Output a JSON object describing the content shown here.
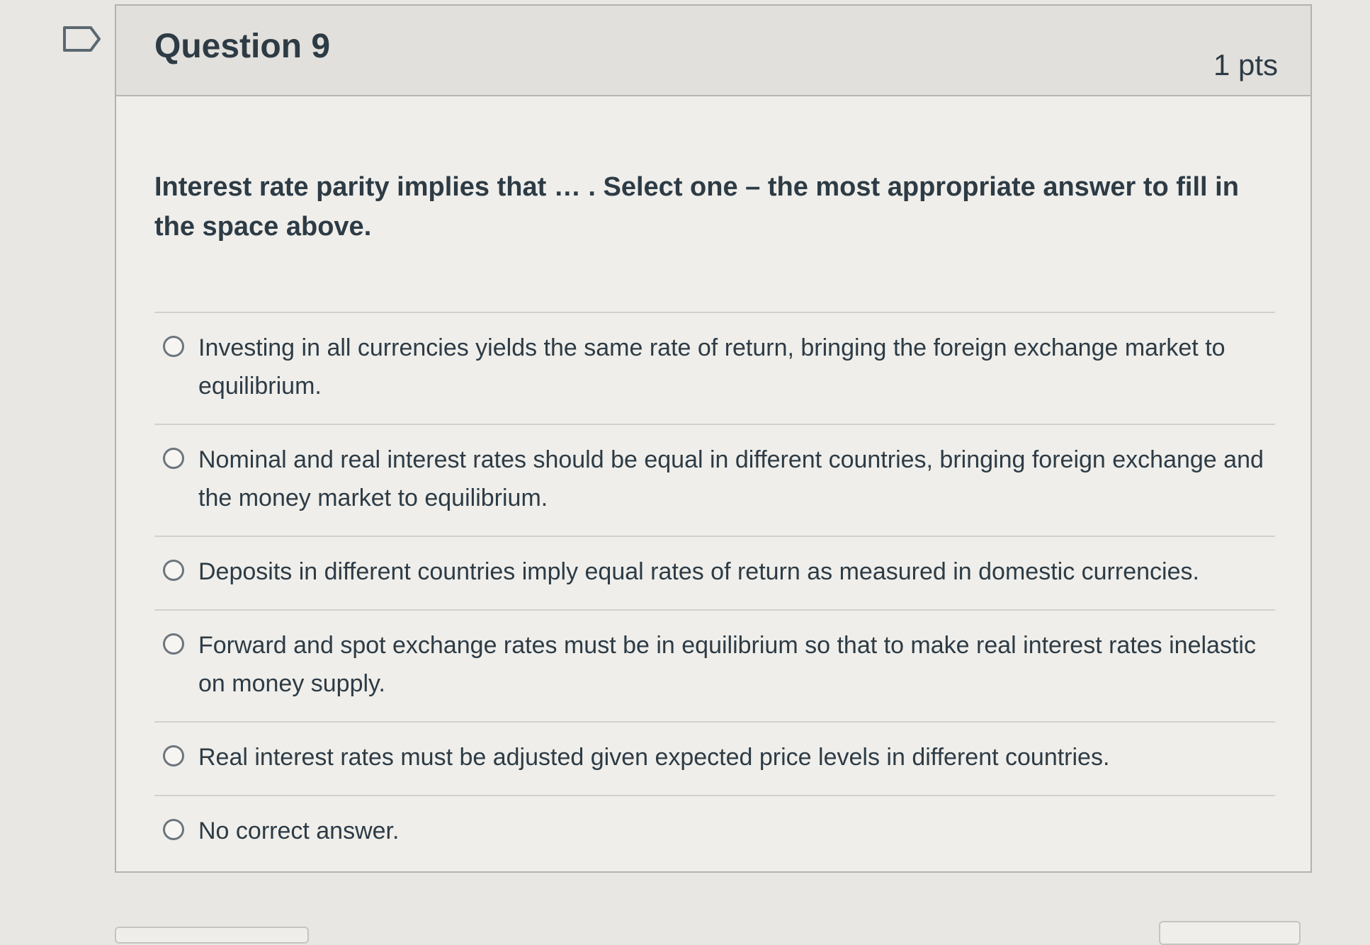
{
  "question": {
    "title": "Question 9",
    "points": "1 pts",
    "text": "Interest rate parity implies that … . Select one – the most appropriate answer to fill in the space above.",
    "flag_icon": "bookmark-flag-icon",
    "answers": [
      {
        "label": "Investing in all currencies yields the same rate of return, bringing the foreign exchange market to equilibrium.",
        "selected": false
      },
      {
        "label": "Nominal and real interest rates should be equal in different countries, bringing foreign exchange and the money market to equilibrium.",
        "selected": false
      },
      {
        "label": "Deposits in different countries imply equal rates of return as measured in domestic currencies.",
        "selected": false
      },
      {
        "label": "Forward and spot exchange rates must be in equilibrium so that to make real interest rates inelastic on money supply.",
        "selected": false
      },
      {
        "label": "Real interest rates must be adjusted given expected price levels in different countries.",
        "selected": false
      },
      {
        "label": "No correct answer.",
        "selected": false
      }
    ]
  },
  "colors": {
    "text": "#2d3b45",
    "background": "#e9e7e3",
    "header_bg": "#e2e0dc",
    "border": "#b4b2ae"
  }
}
